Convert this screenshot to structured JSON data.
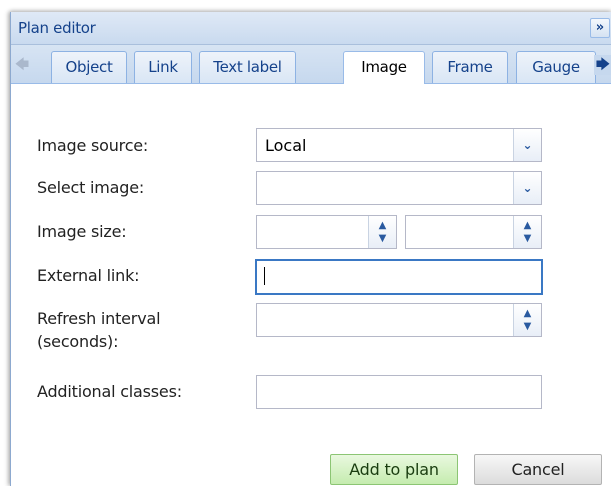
{
  "window": {
    "title": "Plan editor",
    "collapse_glyph": "»"
  },
  "tabs": [
    {
      "label": "Object"
    },
    {
      "label": "Link"
    },
    {
      "label": "Text label"
    },
    {
      "label": "Image",
      "active": true
    },
    {
      "label": "Frame"
    },
    {
      "label": "Gauge"
    }
  ],
  "form": {
    "image_source": {
      "label": "Image source:",
      "value": "Local"
    },
    "select_image": {
      "label": "Select image:",
      "value": ""
    },
    "image_size": {
      "label": "Image size:",
      "width": "",
      "height": ""
    },
    "external_link": {
      "label": "External link:",
      "value": ""
    },
    "refresh_interval": {
      "label_line1": "Refresh interval",
      "label_line2": "(seconds):",
      "value": ""
    },
    "additional_classes": {
      "label": "Additional classes:",
      "value": ""
    }
  },
  "buttons": {
    "add": "Add to plan",
    "cancel": "Cancel"
  },
  "icons": {
    "scroll_left": "arrow-left-icon",
    "scroll_right": "arrow-right-icon",
    "dropdown": "chevron-down-icon",
    "spinner": "spinner-icon"
  },
  "colors": {
    "title_text": "#15428b",
    "focus_border": "#3a78c4",
    "primary_button": "#c5ecaf"
  }
}
